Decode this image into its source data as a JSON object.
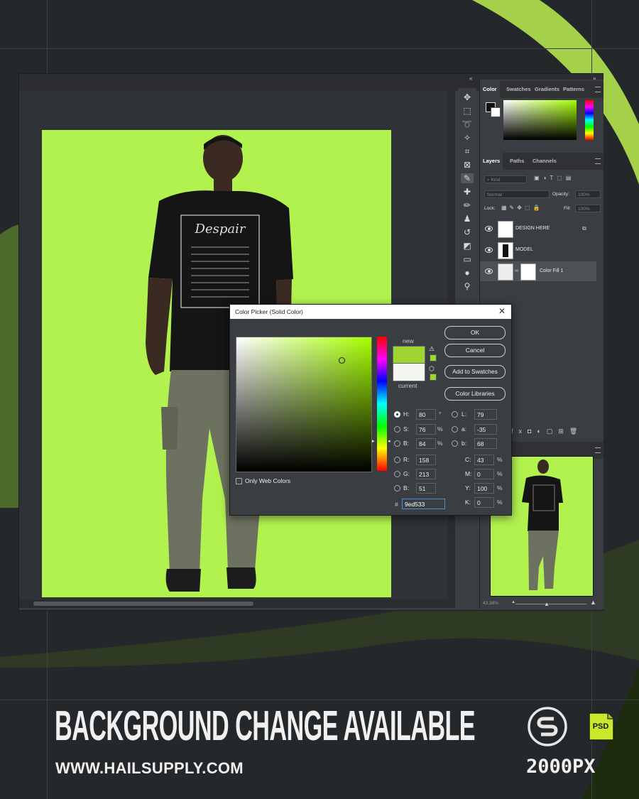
{
  "footer": {
    "headline": "BACKGROUND CHANGE AVAILABLE",
    "website": "WWW.HAILSUPPLY.COM",
    "size_label": "2000PX",
    "psd_badge": "PSD"
  },
  "colors": {
    "canvas_green": "#b1f24f",
    "accent_green": "#9ed533",
    "background": "#25282b"
  },
  "panels": {
    "top_tabs": [
      "Color",
      "Swatches",
      "Gradients",
      "Patterns"
    ],
    "layer_tabs": [
      "Layers",
      "Paths",
      "Channels"
    ],
    "filter_placeholder": "Kind",
    "blend_mode": "Normal",
    "opacity_label": "Opacity:",
    "opacity_value": "100%",
    "lock_label": "Lock:",
    "fill_label": "Fill:",
    "fill_value": "100%",
    "layers": [
      {
        "name": "DESIGN HERE"
      },
      {
        "name": "MODEL"
      },
      {
        "name": "Color Fill 1"
      }
    ],
    "zoom": "43.38%"
  },
  "dialog": {
    "title": "Color Picker (Solid Color)",
    "new_label": "new",
    "current_label": "current",
    "ok": "OK",
    "cancel": "Cancel",
    "add_to_swatches": "Add to Swatches",
    "color_libraries": "Color Libraries",
    "only_web_colors": "Only Web Colors",
    "hsb": {
      "H": "80",
      "S": "76",
      "B": "84"
    },
    "rgb": {
      "R": "158",
      "G": "213",
      "B": "51"
    },
    "lab": {
      "L": "79",
      "a": "-35",
      "b": "68"
    },
    "cmyk": {
      "C": "43",
      "M": "0",
      "Y": "100",
      "K": "0"
    },
    "hex_label": "#",
    "hex": "9ed533",
    "units": {
      "degree": "°",
      "percent": "%"
    }
  }
}
